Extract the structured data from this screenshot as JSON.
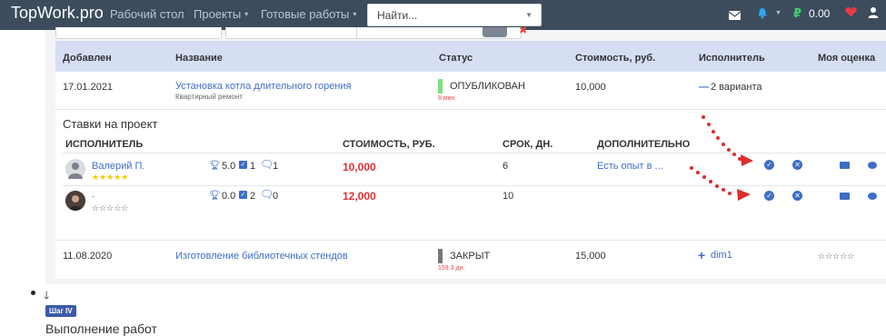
{
  "nav": {
    "brand": "TopWork.pro",
    "items": [
      {
        "label": "Рабочий стол"
      },
      {
        "label": "Проекты",
        "caret": "▾"
      },
      {
        "label": "Готовые работы",
        "caret": "▾"
      }
    ],
    "search_placeholder": "Найти...",
    "balance": "0.00",
    "currency_symbol": "₽"
  },
  "table": {
    "headers": [
      "Добавлен",
      "Название",
      "Статус",
      "Стоимость, руб.",
      "Исполнитель",
      "Моя оценка"
    ],
    "rows": [
      {
        "date": "17.01.2021",
        "title": "Установка котла длительного горения",
        "category": "Квартирный ремонт",
        "status": "ОПУБЛИКОВАН",
        "status_time": "8 мин.",
        "status_color": "#7ee07e",
        "cost": "10,000",
        "executor": "2 варианта",
        "executor_prefix": "—"
      },
      {
        "date": "11.08.2020",
        "title": "Изготовление библиотечных стендов",
        "category": "",
        "status": "ЗАКРЫТ",
        "status_time": "159.3 дн.",
        "status_color": "#777777",
        "cost": "15,000",
        "executor": "dim1",
        "executor_prefix": "+",
        "rating": "☆☆☆☆☆"
      }
    ]
  },
  "bids": {
    "title": "Ставки на проект",
    "headers": [
      "ИСПОЛНИТЕЛЬ",
      "СТОИМОСТЬ, РУБ.",
      "СРОК, ДН.",
      "ДОПОЛНИТЕЛЬНО"
    ],
    "items": [
      {
        "name": "Валерий П.",
        "stars": "★★★★★",
        "rating": "5.0",
        "done": "1",
        "comments": "1",
        "cost": "10,000",
        "days": "6",
        "extra": "Есть опыт в ..."
      },
      {
        "name": ".",
        "stars": "☆☆☆☆☆",
        "rating": "0.0",
        "done": "2",
        "comments": "0",
        "cost": "12,000",
        "days": "10",
        "extra": ""
      }
    ]
  },
  "colors": {
    "navbar": "#3c4c5c",
    "table_header": "#d6def4",
    "link": "#3e6ec5",
    "price_red": "#e03131",
    "badge": "#3c5aa8"
  },
  "step": {
    "arrow": "🡓",
    "badge": "Шаг IV",
    "text": "Выполнение работ"
  }
}
